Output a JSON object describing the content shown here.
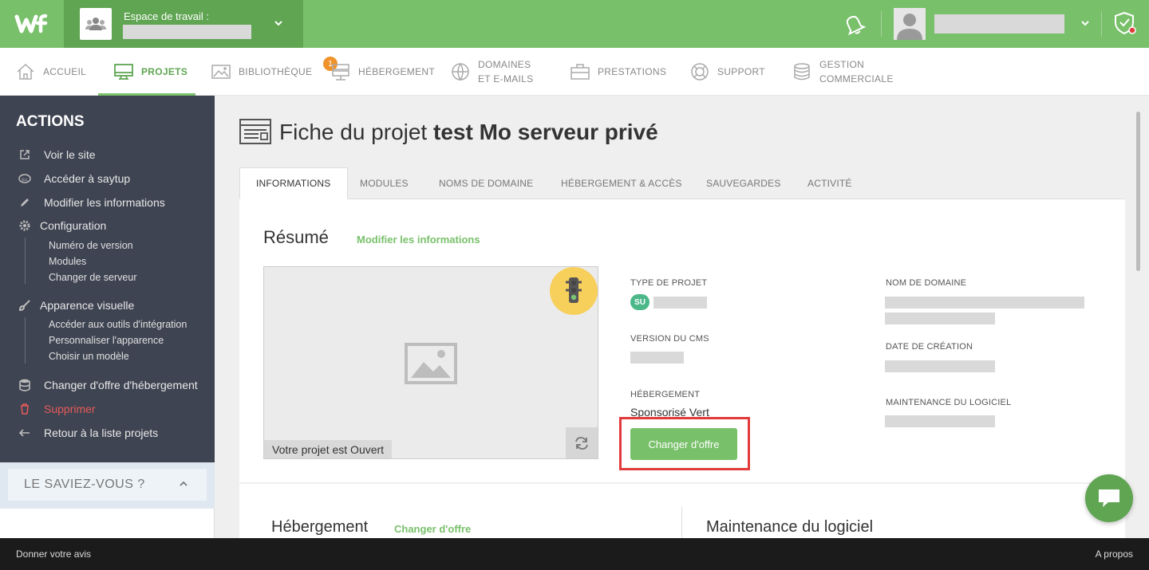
{
  "topbar": {
    "workspace_label": "Espace de travail :"
  },
  "nav": {
    "items": [
      {
        "label": "ACCUEIL"
      },
      {
        "label": "PROJETS"
      },
      {
        "label": "BIBLIOTHÈQUE"
      },
      {
        "label": "HÉBERGEMENT",
        "badge": "1"
      },
      {
        "label_line1": "DOMAINES",
        "label_line2": "ET E-MAILS"
      },
      {
        "label": "PRESTATIONS"
      },
      {
        "label": "SUPPORT"
      },
      {
        "label_line1": "GESTION",
        "label_line2": "COMMERCIALE"
      }
    ]
  },
  "sidebar": {
    "title": "ACTIONS",
    "items": {
      "voir_site": "Voir le site",
      "saytup": "Accéder à saytup",
      "modifier": "Modifier les informations",
      "configuration": "Configuration",
      "config_sub": [
        "Numéro de version",
        "Modules",
        "Changer de serveur"
      ],
      "apparence": "Apparence visuelle",
      "apparence_sub": [
        "Accéder aux outils d'intégration",
        "Personnaliser l'apparence",
        "Choisir un modèle"
      ],
      "changer_offre": "Changer d'offre d'hébergement",
      "supprimer": "Supprimer",
      "retour": "Retour à la liste projets"
    },
    "saviez": "LE SAVIEZ-VOUS ?"
  },
  "main": {
    "title_prefix": "Fiche du projet",
    "title_project": "test Mo serveur privé",
    "tabs": [
      "INFORMATIONS",
      "MODULES",
      "NOMS DE DOMAINE",
      "HÉBERGEMENT & ACCÈS",
      "SAUVEGARDES",
      "ACTIVITÉ"
    ],
    "resume": "Résumé",
    "modifier_link": "Modifier les informations",
    "thumb_status": "Votre projet est Ouvert",
    "labels": {
      "type_projet": "TYPE DE PROJET",
      "version_cms": "VERSION DU CMS",
      "hebergement": "HÉBERGEMENT",
      "nom_domaine": "NOM DE DOMAINE",
      "date_creation": "DATE DE CRÉATION",
      "maintenance": "MAINTENANCE DU LOGICIEL"
    },
    "su_badge": "SU",
    "hosting_value": "Sponsorisé Vert",
    "change_button": "Changer d'offre",
    "section_hosting": "Hébergement",
    "section_hosting_link": "Changer d'offre",
    "section_maintenance": "Maintenance du logiciel"
  },
  "footer": {
    "left": "Donner votre avis",
    "right": "A propos"
  },
  "colors": {
    "brand_green": "#79c06b",
    "dark_green": "#5fa552",
    "sidebar_bg": "#3f4452",
    "highlight_red": "#e23b3b",
    "badge_orange": "#f0932b"
  }
}
